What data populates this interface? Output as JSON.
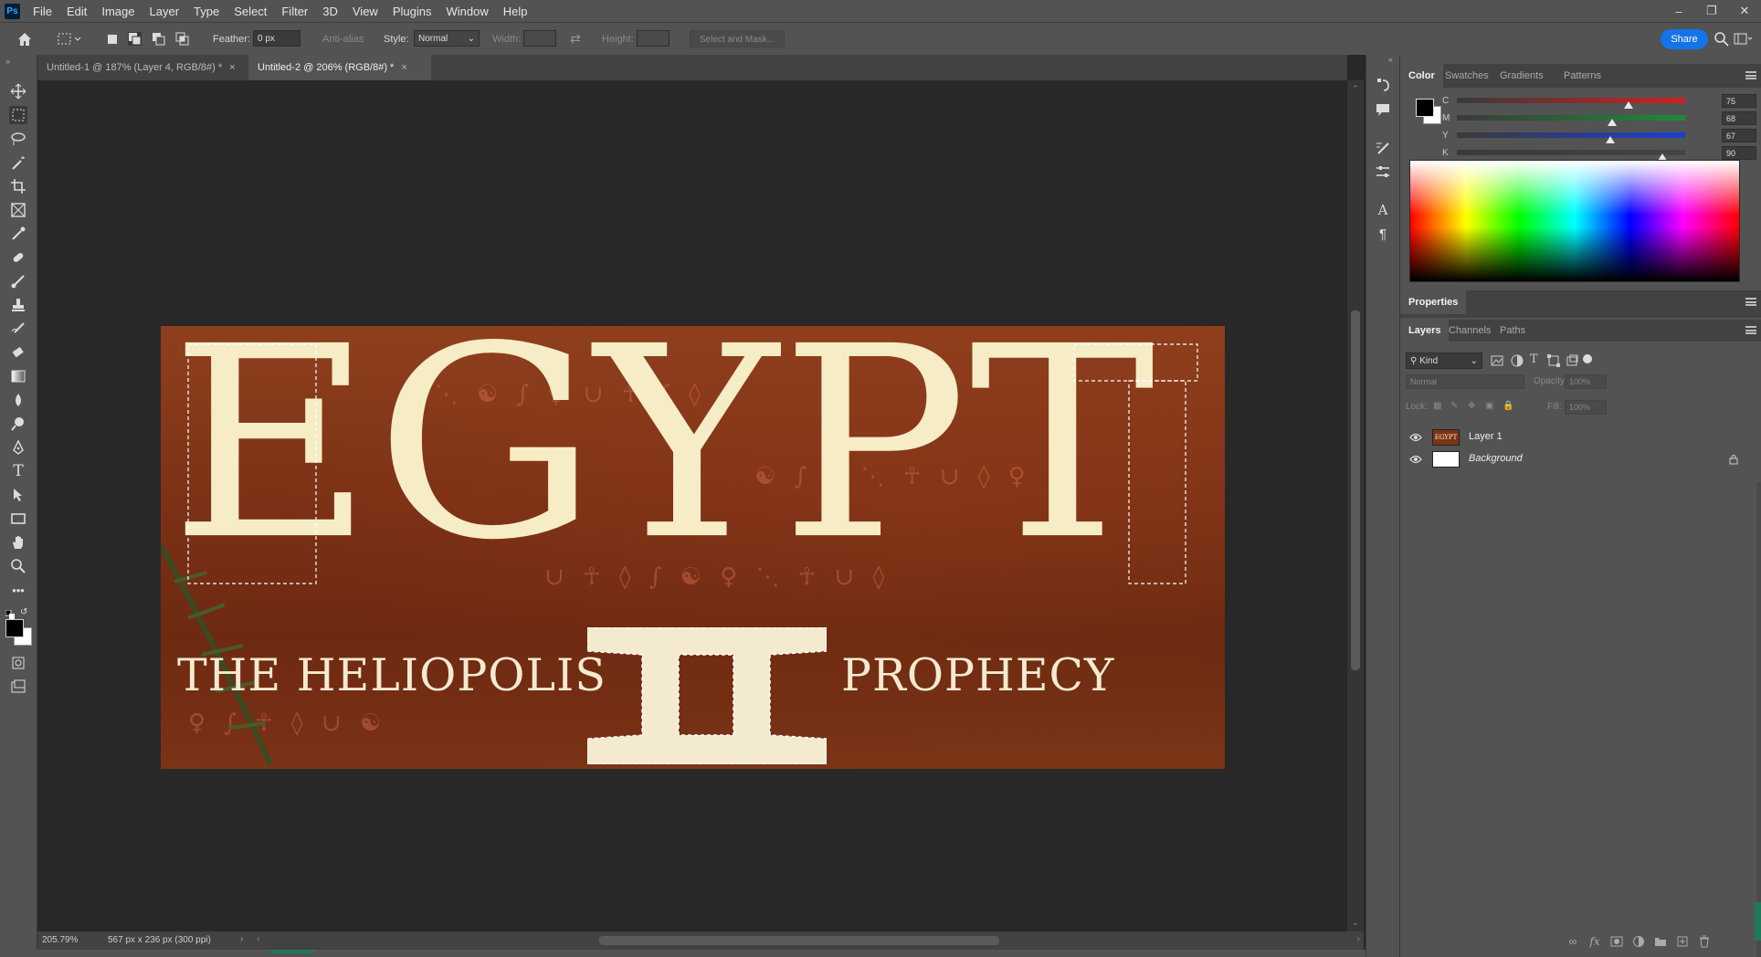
{
  "app": {
    "logo_text": "Ps"
  },
  "menu": [
    "File",
    "Edit",
    "Image",
    "Layer",
    "Type",
    "Select",
    "Filter",
    "3D",
    "View",
    "Plugins",
    "Window",
    "Help"
  ],
  "options_bar": {
    "feather_label": "Feather:",
    "feather_value": "0 px",
    "anti_alias_label": "Anti-alias",
    "style_label": "Style:",
    "style_value": "Normal",
    "width_label": "Width:",
    "height_label": "Height:",
    "select_mask_label": "Select and Mask...",
    "share_label": "Share"
  },
  "tabs": [
    {
      "label": "Untitled-1 @ 187% (Layer 4, RGB/8#) *",
      "active": false
    },
    {
      "label": "Untitled-2 @ 206% (RGB/8#) *",
      "active": true
    }
  ],
  "document": {
    "title_word": "EGYPT",
    "subtitle_left": "THE HELIOPOLIS",
    "numeral": "II",
    "subtitle_right": "PROPHECY"
  },
  "status": {
    "zoom": "205.79%",
    "doc_info": "567 px x 236 px (300 ppi)"
  },
  "color_panel": {
    "tabs": [
      "Color",
      "Swatches",
      "Gradients",
      "Patterns"
    ],
    "channels": [
      {
        "letter": "C",
        "value": "75",
        "unit": "%",
        "level": 0.75,
        "color": "#d02020"
      },
      {
        "letter": "M",
        "value": "68",
        "unit": "%",
        "level": 0.68,
        "color": "#1f8a3a"
      },
      {
        "letter": "Y",
        "value": "67",
        "unit": "%",
        "level": 0.67,
        "color": "#1c3fd1"
      },
      {
        "letter": "K",
        "value": "90",
        "unit": "%",
        "level": 0.9,
        "color": "#444444"
      }
    ]
  },
  "properties_panel": {
    "title": "Properties"
  },
  "layers_panel": {
    "tabs": [
      "Layers",
      "Channels",
      "Paths"
    ],
    "filter_kind": "Kind",
    "blend_mode": "Normal",
    "opacity_label": "Opacity:",
    "opacity_value": "100%",
    "lock_label": "Lock:",
    "fill_label": "Fill:",
    "fill_value": "100%",
    "layers": [
      {
        "name": "Layer 1",
        "thumb_text": "EGYPT",
        "italic": false,
        "locked": false
      },
      {
        "name": "Background",
        "thumb_text": "",
        "italic": true,
        "locked": true
      }
    ]
  },
  "colors": {
    "accent": "#1473e6",
    "title_fill": "#f6ecc6",
    "background_fill": "#7d3316"
  }
}
